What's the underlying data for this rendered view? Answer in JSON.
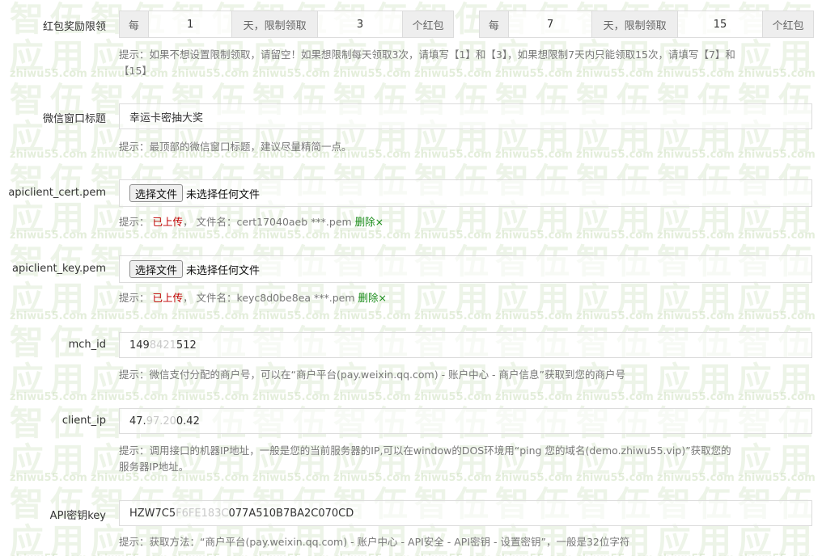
{
  "watermark": {
    "big_text": "智伍应用",
    "url": "zhiwu55.com",
    "color": "#d9e7cd"
  },
  "red_packet": {
    "label": "红包奖励限领",
    "group1": {
      "prefix": "每",
      "days": "1",
      "mid": "天，限制领取",
      "count": "3",
      "suffix": "个红包"
    },
    "group2": {
      "prefix": "每",
      "days": "7",
      "mid": "天，限制领取",
      "count": "15",
      "suffix": "个红包"
    },
    "hint_line1": "提示：如果不想设置限制领取，请留空！如果想限制每天领取3次，请填写【1】和【3】，如果想限制7天内只能领取15次，请填写【7】和",
    "hint_line2": "【15】"
  },
  "wechat_title": {
    "label": "微信窗口标题",
    "value": "幸运卡密抽大奖",
    "hint": "提示：最顶部的微信窗口标题，建议尽量精简一点。"
  },
  "cert": {
    "label": "apiclient_cert.pem",
    "button": "选择文件",
    "no_file": "未选择任何文件",
    "hint_prefix": "提示：",
    "status": "已上传",
    "sep": "，",
    "filename_label": "文件名：",
    "filename": "cert17040aeb ***.pem",
    "delete": "删除×"
  },
  "key": {
    "label": "apiclient_key.pem",
    "button": "选择文件",
    "no_file": "未选择任何文件",
    "hint_prefix": "提示：",
    "status": "已上传",
    "sep": "，",
    "filename_label": "文件名：",
    "filename": "keyc8d0be8ea ***.pem",
    "delete": "删除×"
  },
  "mch_id": {
    "label": "mch_id",
    "value_a": "149",
    "value_blur": "8421",
    "value_b": "512",
    "hint": "提示：微信支付分配的商户号，可以在“商户平台(pay.weixin.qq.com) - 账户中心 - 商户信息”获取到您的商户号"
  },
  "client_ip": {
    "label": "client_ip",
    "value_a": "47.",
    "value_blur": "97.20",
    "value_b": "0.42",
    "hint_line1": "提示：调用接口的机器IP地址，一般是您的当前服务器的IP,可以在window的DOS环境用“ping 您的域名(demo.zhiwu55.vip)”获取您的",
    "hint_line2": "服务器IP地址。"
  },
  "api_key": {
    "label": "API密钥key",
    "value_a": "HZW7C5",
    "value_blur": "F6FE183C",
    "value_b": "077A510B7BA2C070CD",
    "hint": "提示：获取方法：“商户平台(pay.weixin.qq.com) - 账户中心 - API安全 - API密钥 - 设置密钥”，一般是32位字符"
  }
}
